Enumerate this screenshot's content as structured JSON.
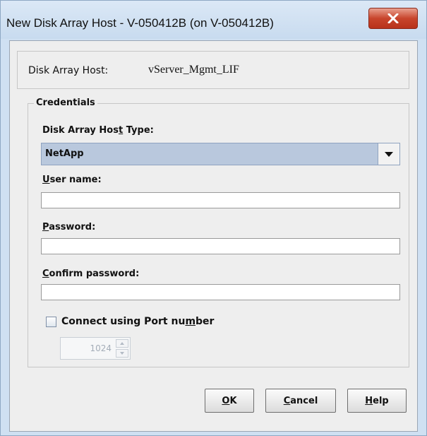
{
  "window": {
    "title": "New Disk Array Host - V-050412B (on V-050412B)",
    "close_icon": "close-icon",
    "accent": "#c8452c"
  },
  "host": {
    "label": "Disk Array Host:",
    "value": "vServer_Mgmt_LIF"
  },
  "credentials": {
    "legend": "Credentials",
    "type_label_a": "Disk Array Hos",
    "type_label_ul": "t",
    "type_label_b": " Type:",
    "type_value": "NetApp",
    "username_ul": "U",
    "username_rest": "ser name:",
    "username_value": "",
    "password_ul": "P",
    "password_rest": "assword:",
    "password_value": "",
    "confirm_ul": "C",
    "confirm_rest": "onfirm password:",
    "confirm_value": "",
    "port_label_a": "Connect using Port nu",
    "port_label_ul": "m",
    "port_label_b": "ber",
    "port_checked": false,
    "port_value": "1024"
  },
  "buttons": {
    "ok_ul": "O",
    "ok_rest": "K",
    "cancel_ul": "C",
    "cancel_rest": "ancel",
    "help_ul": "H",
    "help_rest": "elp"
  }
}
